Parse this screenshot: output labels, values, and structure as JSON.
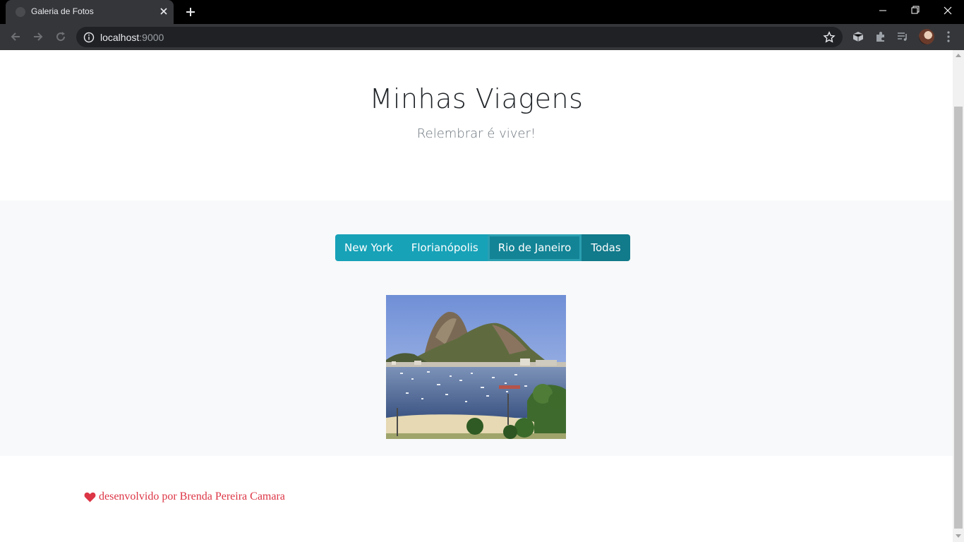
{
  "browser": {
    "tab_title": "Galeria de Fotos",
    "url_host": "localhost",
    "url_port": ":9000"
  },
  "page": {
    "title": "Minhas Viagens",
    "subtitle": "Relembrar é viver!",
    "filters": [
      {
        "label": "New York",
        "active": false
      },
      {
        "label": "Florianópolis",
        "active": false
      },
      {
        "label": "Rio de Janeiro",
        "active": true
      },
      {
        "label": "Todas",
        "active": false
      }
    ],
    "credit": "desenvolvido por Brenda Pereira Camara"
  },
  "colors": {
    "accent": "#17a2b8",
    "accent_dark": "#138496",
    "credit_red": "#dc3545"
  }
}
